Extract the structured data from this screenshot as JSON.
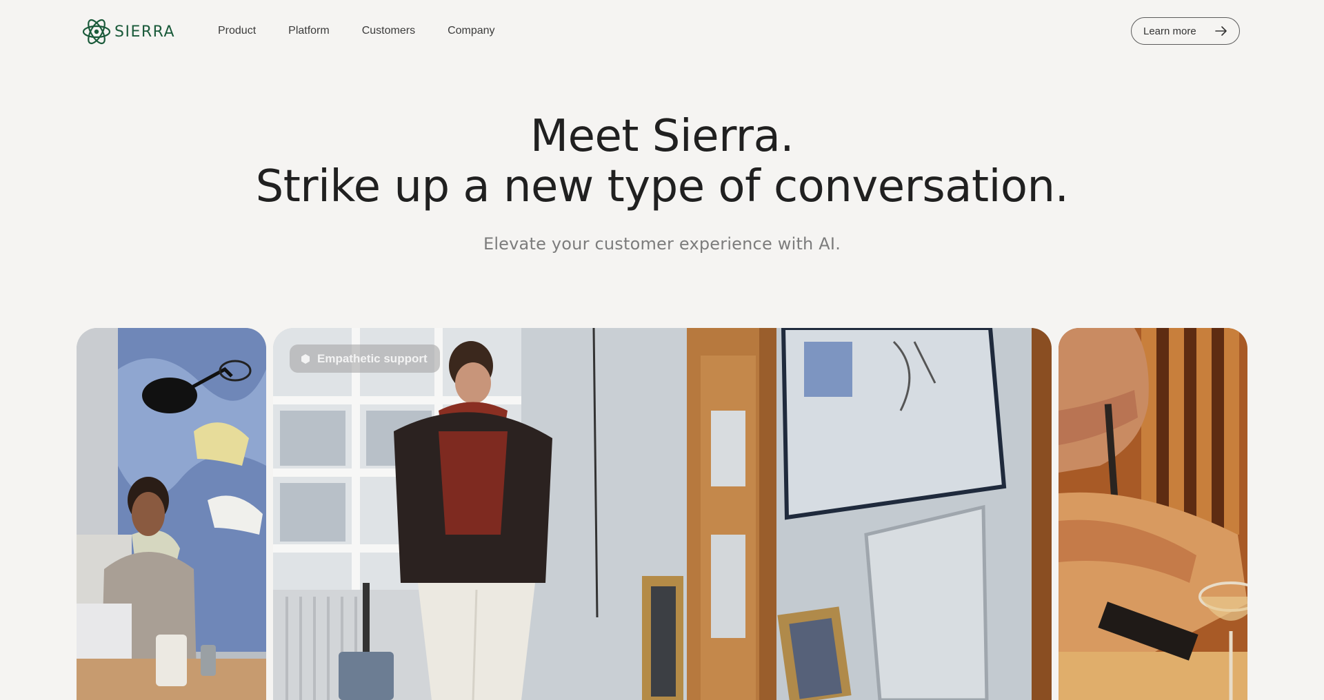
{
  "brand": {
    "name": "SIERRA",
    "logo_icon": "atom-logo-icon",
    "color": "#1a5a3a"
  },
  "nav": {
    "items": [
      {
        "label": "Product"
      },
      {
        "label": "Platform"
      },
      {
        "label": "Customers"
      },
      {
        "label": "Company"
      }
    ],
    "cta": {
      "label": "Learn more",
      "icon": "arrow-right-icon"
    }
  },
  "hero": {
    "title_line1": "Meet Sierra.",
    "title_line2": "Strike up a new type of conversation.",
    "subtitle": "Elevate your customer experience with AI."
  },
  "cards": {
    "main_tag": {
      "label": "Empathetic support",
      "icon": "hexagon-icon"
    }
  },
  "colors": {
    "background": "#f5f4f2",
    "text": "#1f1f1f",
    "muted": "#7c7c7c"
  }
}
